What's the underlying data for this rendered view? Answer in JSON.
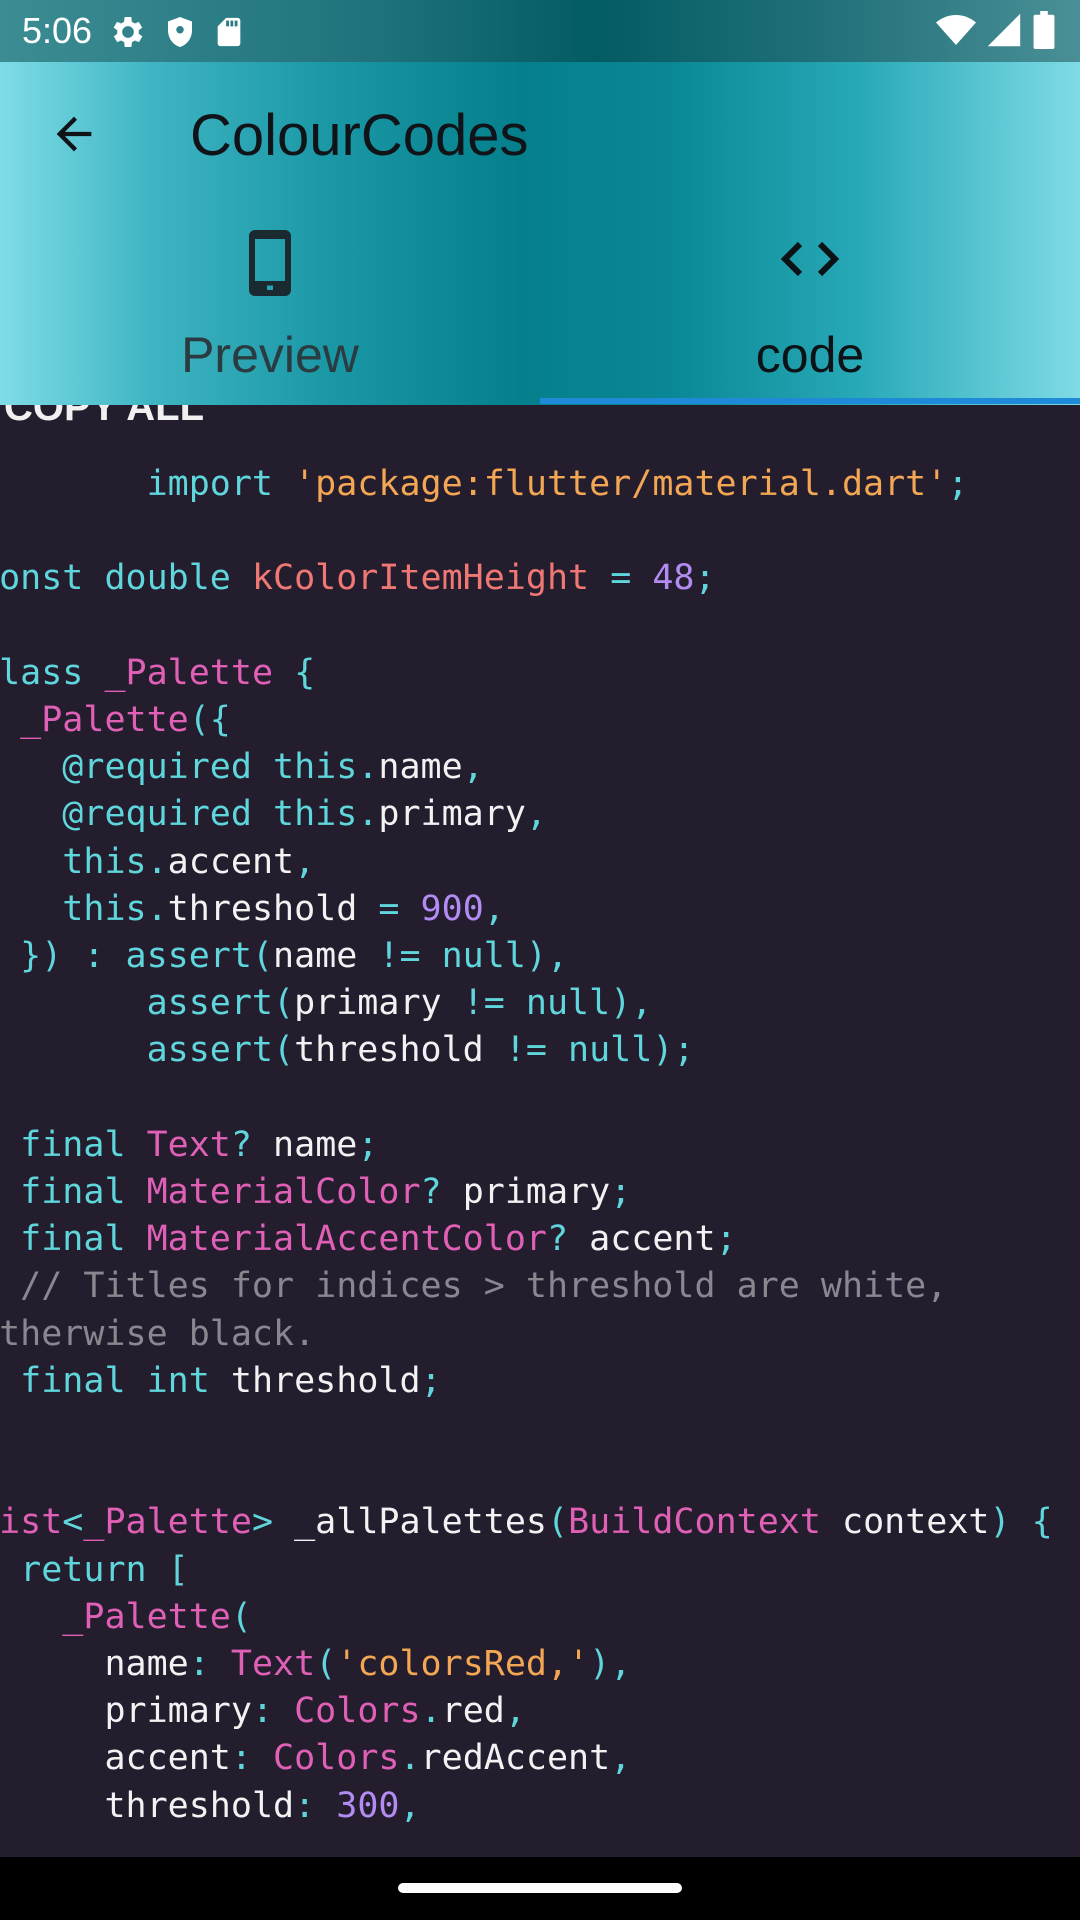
{
  "status_bar": {
    "time": "5:06",
    "icons_left": [
      "gear-icon",
      "shield-icon",
      "sd-card-icon"
    ],
    "icons_right": [
      "wifi-icon",
      "signal-icon",
      "battery-icon"
    ]
  },
  "app_bar": {
    "title": "ColourCodes",
    "back_icon": "arrow-back-icon"
  },
  "tabs": [
    {
      "label": "Preview",
      "icon": "phone-icon",
      "selected": false
    },
    {
      "label": "code",
      "icon": "code-brackets-icon",
      "selected": true
    }
  ],
  "colors": {
    "indicator": "#1f8ad8",
    "code_background": "#231d2e",
    "keyword": "#5fd6dc",
    "string": "#f3a653",
    "type": "#e060b6",
    "identifier_red": "#f07874",
    "number": "#b28cf3",
    "comment": "#8a8790"
  },
  "code": {
    "copy_all_label": "COPY ALL",
    "lines": [
      [
        {
          "t": "        "
        },
        {
          "t": "import ",
          "c": "k"
        },
        {
          "t": "'package:flutter/material.dart'",
          "c": "s"
        },
        {
          "t": ";",
          "c": "k"
        }
      ],
      [],
      [
        {
          "t": "const ",
          "c": "k"
        },
        {
          "t": "double ",
          "c": "k"
        },
        {
          "t": "kColorItemHeight ",
          "c": "r"
        },
        {
          "t": "= ",
          "c": "k"
        },
        {
          "t": "48",
          "c": "n"
        },
        {
          "t": ";",
          "c": "k"
        }
      ],
      [],
      [
        {
          "t": "class ",
          "c": "k"
        },
        {
          "t": "_Palette ",
          "c": "t"
        },
        {
          "t": "{",
          "c": "k"
        }
      ],
      [
        {
          "t": "  "
        },
        {
          "t": "_Palette",
          "c": "t"
        },
        {
          "t": "({",
          "c": "k"
        }
      ],
      [
        {
          "t": "    "
        },
        {
          "t": "@required ",
          "c": "k"
        },
        {
          "t": "this",
          "c": "k"
        },
        {
          "t": ".",
          "c": "k"
        },
        {
          "t": "name",
          "c": "w"
        },
        {
          "t": ",",
          "c": "k"
        }
      ],
      [
        {
          "t": "    "
        },
        {
          "t": "@required ",
          "c": "k"
        },
        {
          "t": "this",
          "c": "k"
        },
        {
          "t": ".",
          "c": "k"
        },
        {
          "t": "primary",
          "c": "w"
        },
        {
          "t": ",",
          "c": "k"
        }
      ],
      [
        {
          "t": "    "
        },
        {
          "t": "this",
          "c": "k"
        },
        {
          "t": ".",
          "c": "k"
        },
        {
          "t": "accent",
          "c": "w"
        },
        {
          "t": ",",
          "c": "k"
        }
      ],
      [
        {
          "t": "    "
        },
        {
          "t": "this",
          "c": "k"
        },
        {
          "t": ".",
          "c": "k"
        },
        {
          "t": "threshold ",
          "c": "w"
        },
        {
          "t": "= ",
          "c": "k"
        },
        {
          "t": "900",
          "c": "n"
        },
        {
          "t": ",",
          "c": "k"
        }
      ],
      [
        {
          "t": "  "
        },
        {
          "t": "}) : ",
          "c": "k"
        },
        {
          "t": "assert",
          "c": "k"
        },
        {
          "t": "(",
          "c": "k"
        },
        {
          "t": "name ",
          "c": "w"
        },
        {
          "t": "!= ",
          "c": "k"
        },
        {
          "t": "null",
          "c": "k"
        },
        {
          "t": "),",
          "c": "k"
        }
      ],
      [
        {
          "t": "        "
        },
        {
          "t": "assert",
          "c": "k"
        },
        {
          "t": "(",
          "c": "k"
        },
        {
          "t": "primary ",
          "c": "w"
        },
        {
          "t": "!= ",
          "c": "k"
        },
        {
          "t": "null",
          "c": "k"
        },
        {
          "t": "),",
          "c": "k"
        }
      ],
      [
        {
          "t": "        "
        },
        {
          "t": "assert",
          "c": "k"
        },
        {
          "t": "(",
          "c": "k"
        },
        {
          "t": "threshold ",
          "c": "w"
        },
        {
          "t": "!= ",
          "c": "k"
        },
        {
          "t": "null",
          "c": "k"
        },
        {
          "t": ");",
          "c": "k"
        }
      ],
      [],
      [
        {
          "t": "  "
        },
        {
          "t": "final ",
          "c": "k"
        },
        {
          "t": "Text",
          "c": "t"
        },
        {
          "t": "? ",
          "c": "k"
        },
        {
          "t": "name",
          "c": "w"
        },
        {
          "t": ";",
          "c": "k"
        }
      ],
      [
        {
          "t": "  "
        },
        {
          "t": "final ",
          "c": "k"
        },
        {
          "t": "MaterialColor",
          "c": "t"
        },
        {
          "t": "? ",
          "c": "k"
        },
        {
          "t": "primary",
          "c": "w"
        },
        {
          "t": ";",
          "c": "k"
        }
      ],
      [
        {
          "t": "  "
        },
        {
          "t": "final ",
          "c": "k"
        },
        {
          "t": "MaterialAccentColor",
          "c": "t"
        },
        {
          "t": "? ",
          "c": "k"
        },
        {
          "t": "accent",
          "c": "w"
        },
        {
          "t": ";",
          "c": "k"
        }
      ],
      [
        {
          "t": "  // Titles for indices > threshold are white,",
          "c": "c"
        }
      ],
      [
        {
          "t": "otherwise black.",
          "c": "c"
        }
      ],
      [
        {
          "t": "  "
        },
        {
          "t": "final ",
          "c": "k"
        },
        {
          "t": "int ",
          "c": "k"
        },
        {
          "t": "threshold",
          "c": "w"
        },
        {
          "t": ";",
          "c": "k"
        }
      ],
      [],
      [],
      [
        {
          "t": "List",
          "c": "t"
        },
        {
          "t": "<",
          "c": "k"
        },
        {
          "t": "_Palette",
          "c": "t"
        },
        {
          "t": "> ",
          "c": "k"
        },
        {
          "t": "_allPalettes",
          "c": "w"
        },
        {
          "t": "(",
          "c": "k"
        },
        {
          "t": "BuildContext ",
          "c": "t"
        },
        {
          "t": "context",
          "c": "w"
        },
        {
          "t": ") {",
          "c": "k"
        }
      ],
      [
        {
          "t": "  "
        },
        {
          "t": "return ",
          "c": "k"
        },
        {
          "t": "[",
          "c": "k"
        }
      ],
      [
        {
          "t": "    "
        },
        {
          "t": "_Palette",
          "c": "t"
        },
        {
          "t": "(",
          "c": "k"
        }
      ],
      [
        {
          "t": "      "
        },
        {
          "t": "name",
          "c": "w"
        },
        {
          "t": ": ",
          "c": "k"
        },
        {
          "t": "Text",
          "c": "t"
        },
        {
          "t": "(",
          "c": "k"
        },
        {
          "t": "'colorsRed,'",
          "c": "s"
        },
        {
          "t": "),",
          "c": "k"
        }
      ],
      [
        {
          "t": "      "
        },
        {
          "t": "primary",
          "c": "w"
        },
        {
          "t": ": ",
          "c": "k"
        },
        {
          "t": "Colors",
          "c": "t"
        },
        {
          "t": ".",
          "c": "k"
        },
        {
          "t": "red",
          "c": "w"
        },
        {
          "t": ",",
          "c": "k"
        }
      ],
      [
        {
          "t": "      "
        },
        {
          "t": "accent",
          "c": "w"
        },
        {
          "t": ": ",
          "c": "k"
        },
        {
          "t": "Colors",
          "c": "t"
        },
        {
          "t": ".",
          "c": "k"
        },
        {
          "t": "redAccent",
          "c": "w"
        },
        {
          "t": ",",
          "c": "k"
        }
      ],
      [
        {
          "t": "      "
        },
        {
          "t": "threshold",
          "c": "w"
        },
        {
          "t": ": ",
          "c": "k"
        },
        {
          "t": "300",
          "c": "n"
        },
        {
          "t": ",",
          "c": "k"
        }
      ]
    ]
  }
}
